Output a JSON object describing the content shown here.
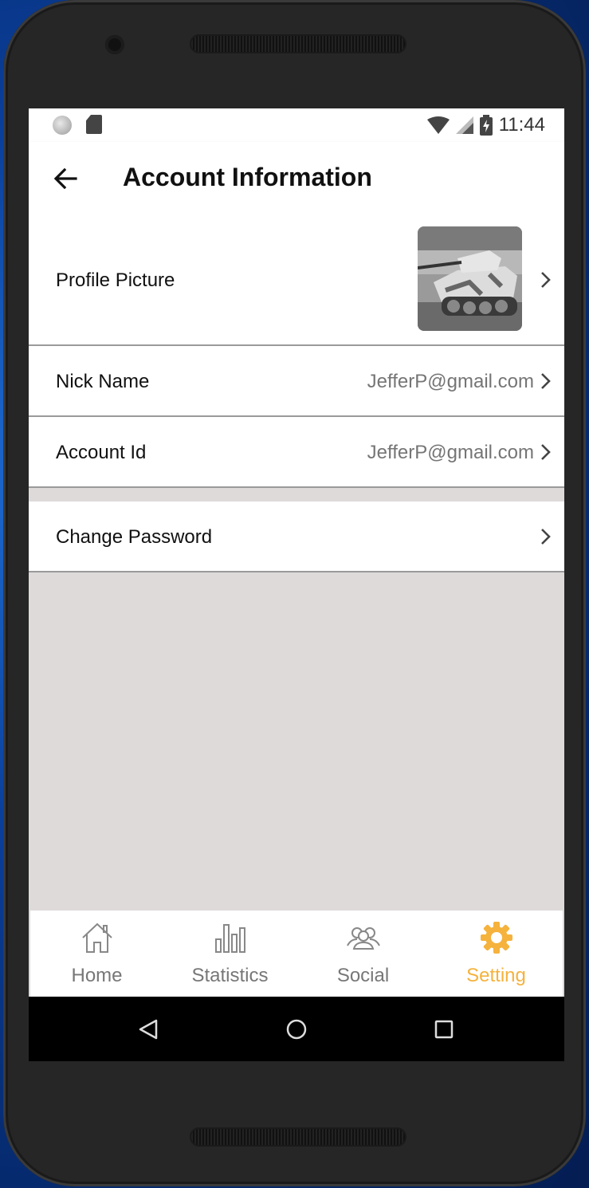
{
  "status_bar": {
    "time": "11:44",
    "icons": [
      "notification-dot-icon",
      "sd-card-icon",
      "wifi-icon",
      "signal-icon",
      "battery-charging-icon"
    ]
  },
  "app_bar": {
    "back_icon": "arrow-left-icon",
    "title": "Account Information"
  },
  "rows": {
    "profile_picture": {
      "label": "Profile Picture",
      "image": "tank-photo"
    },
    "nick_name": {
      "label": "Nick Name",
      "value": "JefferP@gmail.com"
    },
    "account_id": {
      "label": "Account Id",
      "value": "JefferP@gmail.com"
    },
    "change_password": {
      "label": "Change Password"
    }
  },
  "tab_bar": {
    "tabs": [
      {
        "label": "Home",
        "icon": "home-icon",
        "active": false
      },
      {
        "label": "Statistics",
        "icon": "bar-chart-icon",
        "active": false
      },
      {
        "label": "Social",
        "icon": "people-icon",
        "active": false
      },
      {
        "label": "Setting",
        "icon": "gear-icon",
        "active": true
      }
    ]
  },
  "colors": {
    "accent": "#f5b23c",
    "inactive": "#777777",
    "screen_background": "#dedada"
  },
  "nav_bar": {
    "icons": [
      "back-triangle-icon",
      "home-circle-icon",
      "recents-square-icon"
    ]
  }
}
